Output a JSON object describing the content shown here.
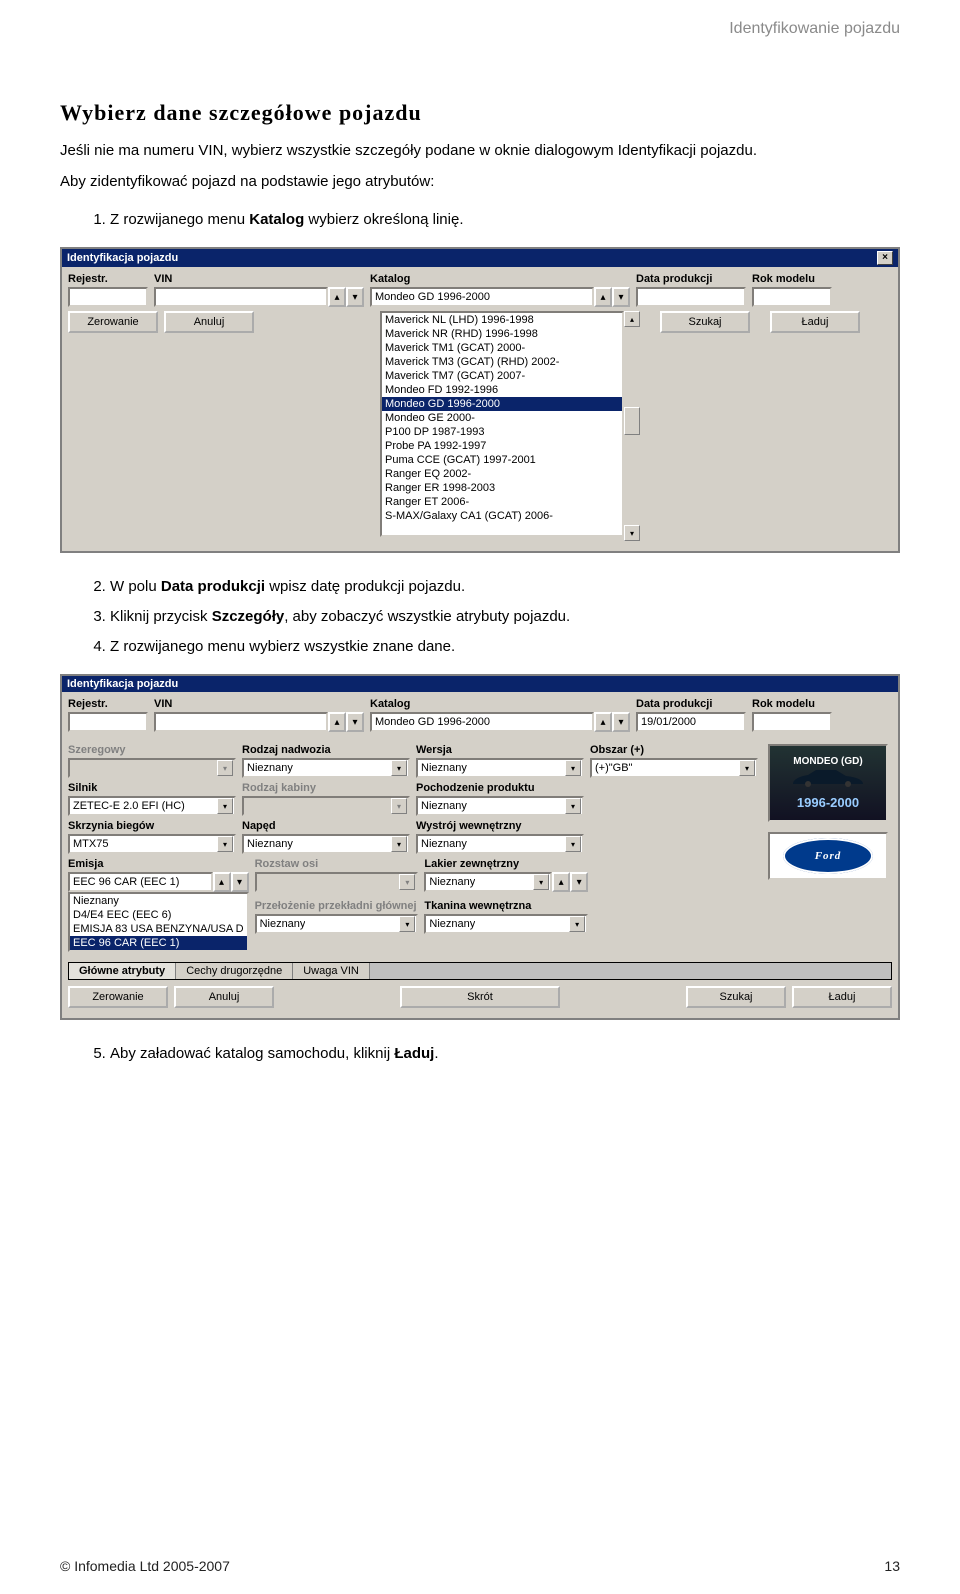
{
  "header": {
    "breadcrumb": "Identyfikowanie pojazdu"
  },
  "title": "Wybierz dane szczegółowe pojazdu",
  "intro_top": "Jeśli nie ma numeru VIN, wybierz wszystkie szczegóły podane w oknie dialogowym Identyfikacji pojazdu.",
  "intro_cmd": "Aby zidentyfikować pojazd na podstawie jego atrybutów:",
  "steps": {
    "s1_pre": "Z rozwijanego menu ",
    "s1_b": "Katalog",
    "s1_post": " wybierz określoną linię.",
    "s2_pre": "W polu ",
    "s2_b": "Data produkcji",
    "s2_post": " wpisz datę produkcji pojazdu.",
    "s3_pre": "Kliknij przycisk ",
    "s3_b": "Szczegóły",
    "s3_post": ", aby zobaczyć wszystkie atrybuty pojazdu.",
    "s4": "Z rozwijanego menu wybierz wszystkie znane dane.",
    "s5_pre": "Aby załadować katalog samochodu, kliknij ",
    "s5_b": "Ładuj",
    "s5_post": "."
  },
  "dlg1": {
    "title": "Identyfikacja pojazdu",
    "labels": {
      "rejestr": "Rejestr.",
      "vin": "VIN",
      "katalog": "Katalog",
      "data": "Data produkcji",
      "rok": "Rok modelu"
    },
    "buttons": {
      "zerowanie": "Zerowanie",
      "anuluj": "Anuluj",
      "szukaj": "Szukaj",
      "laduj": "Ładuj"
    },
    "katalog_selected": "Mondeo GD 1996-2000",
    "katalog_list": [
      "Maverick NL (LHD) 1996-1998",
      "Maverick NR (RHD) 1996-1998",
      "Maverick TM1 (GCAT) 2000-",
      "Maverick TM3 (GCAT) (RHD) 2002-",
      "Maverick TM7 (GCAT) 2007-",
      "Mondeo FD 1992-1996",
      "Mondeo GD 1996-2000",
      "Mondeo GE 2000-",
      "P100 DP 1987-1993",
      "Probe PA 1992-1997",
      "Puma CCE (GCAT) 1997-2001",
      "Ranger EQ 2002-",
      "Ranger ER 1998-2003",
      "Ranger ET 2006-",
      "S-MAX/Galaxy CA1 (GCAT) 2006-"
    ],
    "katalog_selected_idx": 6
  },
  "dlg2": {
    "title": "Identyfikacja pojazdu",
    "labels": {
      "rejestr": "Rejestr.",
      "vin": "VIN",
      "katalog": "Katalog",
      "data": "Data produkcji",
      "rok": "Rok modelu",
      "szeregowy": "Szeregowy",
      "rodzaj_nadwozia": "Rodzaj nadwozia",
      "wersja": "Wersja",
      "obszar": "Obszar (+)",
      "silnik": "Silnik",
      "rodzaj_kabiny": "Rodzaj kabiny",
      "pochodzenie": "Pochodzenie produktu",
      "skrzynia": "Skrzynia biegów",
      "naped": "Napęd",
      "wystroj": "Wystrój wewnętrzny",
      "emisja": "Emisja",
      "rozstaw": "Rozstaw osi",
      "lakier": "Lakier zewnętrzny",
      "przelozenie": "Przełożenie przekładni głównej",
      "tkanina": "Tkanina wewnętrzna"
    },
    "values": {
      "katalog": "Mondeo GD 1996-2000",
      "data": "19/01/2000",
      "nieznany": "Nieznany",
      "obszar": "(+)\"GB\"",
      "silnik": "ZETEC-E 2.0 EFI (HC)",
      "skrzynia": "MTX75",
      "emisja_list": [
        "Nieznany",
        "D4/E4 EEC (EEC 6)",
        "EMISJA 83 USA BENZYNA/USA D",
        "EEC 96 CAR (EEC 1)"
      ],
      "emisja_selected": "EEC 96 CAR (EEC 1)"
    },
    "car_badge": {
      "model": "MONDEO (GD)",
      "years": "1996-2000"
    },
    "ford": "Ford",
    "tabs": [
      "Główne atrybuty",
      "Cechy drugorzędne",
      "Uwaga VIN"
    ],
    "buttons": {
      "zerowanie": "Zerowanie",
      "anuluj": "Anuluj",
      "skrot": "Skrót",
      "szukaj": "Szukaj",
      "laduj": "Ładuj"
    }
  },
  "footer": {
    "copyright": "© Infomedia Ltd 2005-2007",
    "page": "13"
  }
}
